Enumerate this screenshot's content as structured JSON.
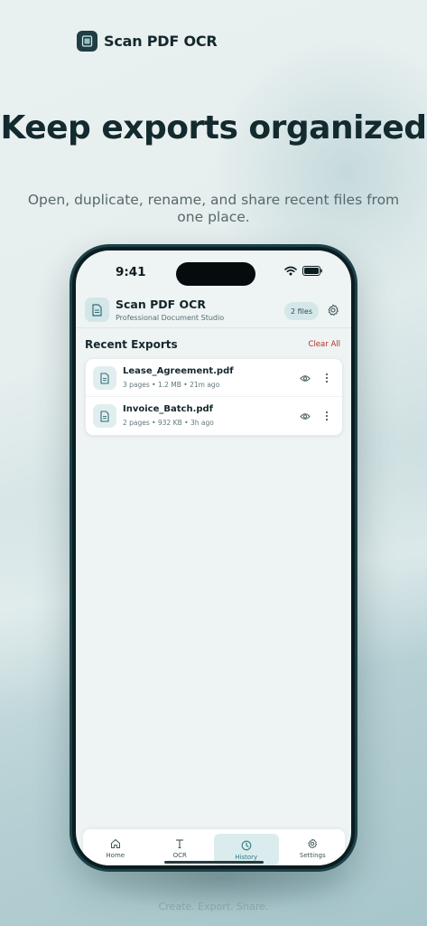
{
  "brand": {
    "name": "Scan PDF OCR",
    "logo_icon": "scanner-icon"
  },
  "hero": {
    "headline": "Keep exports organized",
    "subline": "Open, duplicate, rename, and share recent files from one place."
  },
  "footer": {
    "tagline": "Create. Export. Share."
  },
  "status_bar": {
    "time": "9:41"
  },
  "app": {
    "title": "Scan PDF OCR",
    "subtitle": "Professional Document Studio",
    "files_badge": "2 files",
    "section_title": "Recent Exports",
    "clear_all": "Clear All",
    "files": [
      {
        "name": "Lease_Agreement.pdf",
        "meta": "3 pages • 1.2 MB • 21m ago"
      },
      {
        "name": "Invoice_Batch.pdf",
        "meta": "2 pages • 932 KB • 3h ago"
      }
    ],
    "tabs": [
      {
        "label": "Home",
        "icon": "home-icon"
      },
      {
        "label": "OCR",
        "icon": "text-icon"
      },
      {
        "label": "History",
        "icon": "clock-icon",
        "active": true
      },
      {
        "label": "Settings",
        "icon": "gear-icon"
      }
    ]
  },
  "colors": {
    "accent": "#2d7c86",
    "danger": "#b63128",
    "frame": "#1b4148"
  }
}
